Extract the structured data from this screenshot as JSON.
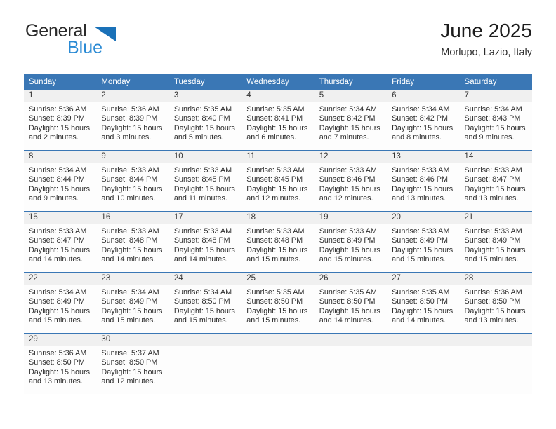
{
  "brand": {
    "name_top": "General",
    "name_bottom": "Blue",
    "triangle_icon": "triangle-icon",
    "accent_color": "#1a71b8",
    "text_color": "#2a8ad4"
  },
  "header": {
    "title": "June 2025",
    "subtitle": "Morlupo, Lazio, Italy"
  },
  "calendar": {
    "header_bg": "#3a77b5",
    "header_text_color": "#ffffff",
    "daynum_band_bg": "#f0f0f0",
    "weekdays": [
      "Sunday",
      "Monday",
      "Tuesday",
      "Wednesday",
      "Thursday",
      "Friday",
      "Saturday"
    ],
    "weeks": [
      [
        {
          "day": "1",
          "sunrise": "Sunrise: 5:36 AM",
          "sunset": "Sunset: 8:39 PM",
          "daylight_line1": "Daylight: 15 hours",
          "daylight_line2": "and 2 minutes."
        },
        {
          "day": "2",
          "sunrise": "Sunrise: 5:36 AM",
          "sunset": "Sunset: 8:39 PM",
          "daylight_line1": "Daylight: 15 hours",
          "daylight_line2": "and 3 minutes."
        },
        {
          "day": "3",
          "sunrise": "Sunrise: 5:35 AM",
          "sunset": "Sunset: 8:40 PM",
          "daylight_line1": "Daylight: 15 hours",
          "daylight_line2": "and 5 minutes."
        },
        {
          "day": "4",
          "sunrise": "Sunrise: 5:35 AM",
          "sunset": "Sunset: 8:41 PM",
          "daylight_line1": "Daylight: 15 hours",
          "daylight_line2": "and 6 minutes."
        },
        {
          "day": "5",
          "sunrise": "Sunrise: 5:34 AM",
          "sunset": "Sunset: 8:42 PM",
          "daylight_line1": "Daylight: 15 hours",
          "daylight_line2": "and 7 minutes."
        },
        {
          "day": "6",
          "sunrise": "Sunrise: 5:34 AM",
          "sunset": "Sunset: 8:42 PM",
          "daylight_line1": "Daylight: 15 hours",
          "daylight_line2": "and 8 minutes."
        },
        {
          "day": "7",
          "sunrise": "Sunrise: 5:34 AM",
          "sunset": "Sunset: 8:43 PM",
          "daylight_line1": "Daylight: 15 hours",
          "daylight_line2": "and 9 minutes."
        }
      ],
      [
        {
          "day": "8",
          "sunrise": "Sunrise: 5:34 AM",
          "sunset": "Sunset: 8:44 PM",
          "daylight_line1": "Daylight: 15 hours",
          "daylight_line2": "and 9 minutes."
        },
        {
          "day": "9",
          "sunrise": "Sunrise: 5:33 AM",
          "sunset": "Sunset: 8:44 PM",
          "daylight_line1": "Daylight: 15 hours",
          "daylight_line2": "and 10 minutes."
        },
        {
          "day": "10",
          "sunrise": "Sunrise: 5:33 AM",
          "sunset": "Sunset: 8:45 PM",
          "daylight_line1": "Daylight: 15 hours",
          "daylight_line2": "and 11 minutes."
        },
        {
          "day": "11",
          "sunrise": "Sunrise: 5:33 AM",
          "sunset": "Sunset: 8:45 PM",
          "daylight_line1": "Daylight: 15 hours",
          "daylight_line2": "and 12 minutes."
        },
        {
          "day": "12",
          "sunrise": "Sunrise: 5:33 AM",
          "sunset": "Sunset: 8:46 PM",
          "daylight_line1": "Daylight: 15 hours",
          "daylight_line2": "and 12 minutes."
        },
        {
          "day": "13",
          "sunrise": "Sunrise: 5:33 AM",
          "sunset": "Sunset: 8:46 PM",
          "daylight_line1": "Daylight: 15 hours",
          "daylight_line2": "and 13 minutes."
        },
        {
          "day": "14",
          "sunrise": "Sunrise: 5:33 AM",
          "sunset": "Sunset: 8:47 PM",
          "daylight_line1": "Daylight: 15 hours",
          "daylight_line2": "and 13 minutes."
        }
      ],
      [
        {
          "day": "15",
          "sunrise": "Sunrise: 5:33 AM",
          "sunset": "Sunset: 8:47 PM",
          "daylight_line1": "Daylight: 15 hours",
          "daylight_line2": "and 14 minutes."
        },
        {
          "day": "16",
          "sunrise": "Sunrise: 5:33 AM",
          "sunset": "Sunset: 8:48 PM",
          "daylight_line1": "Daylight: 15 hours",
          "daylight_line2": "and 14 minutes."
        },
        {
          "day": "17",
          "sunrise": "Sunrise: 5:33 AM",
          "sunset": "Sunset: 8:48 PM",
          "daylight_line1": "Daylight: 15 hours",
          "daylight_line2": "and 14 minutes."
        },
        {
          "day": "18",
          "sunrise": "Sunrise: 5:33 AM",
          "sunset": "Sunset: 8:48 PM",
          "daylight_line1": "Daylight: 15 hours",
          "daylight_line2": "and 15 minutes."
        },
        {
          "day": "19",
          "sunrise": "Sunrise: 5:33 AM",
          "sunset": "Sunset: 8:49 PM",
          "daylight_line1": "Daylight: 15 hours",
          "daylight_line2": "and 15 minutes."
        },
        {
          "day": "20",
          "sunrise": "Sunrise: 5:33 AM",
          "sunset": "Sunset: 8:49 PM",
          "daylight_line1": "Daylight: 15 hours",
          "daylight_line2": "and 15 minutes."
        },
        {
          "day": "21",
          "sunrise": "Sunrise: 5:33 AM",
          "sunset": "Sunset: 8:49 PM",
          "daylight_line1": "Daylight: 15 hours",
          "daylight_line2": "and 15 minutes."
        }
      ],
      [
        {
          "day": "22",
          "sunrise": "Sunrise: 5:34 AM",
          "sunset": "Sunset: 8:49 PM",
          "daylight_line1": "Daylight: 15 hours",
          "daylight_line2": "and 15 minutes."
        },
        {
          "day": "23",
          "sunrise": "Sunrise: 5:34 AM",
          "sunset": "Sunset: 8:49 PM",
          "daylight_line1": "Daylight: 15 hours",
          "daylight_line2": "and 15 minutes."
        },
        {
          "day": "24",
          "sunrise": "Sunrise: 5:34 AM",
          "sunset": "Sunset: 8:50 PM",
          "daylight_line1": "Daylight: 15 hours",
          "daylight_line2": "and 15 minutes."
        },
        {
          "day": "25",
          "sunrise": "Sunrise: 5:35 AM",
          "sunset": "Sunset: 8:50 PM",
          "daylight_line1": "Daylight: 15 hours",
          "daylight_line2": "and 15 minutes."
        },
        {
          "day": "26",
          "sunrise": "Sunrise: 5:35 AM",
          "sunset": "Sunset: 8:50 PM",
          "daylight_line1": "Daylight: 15 hours",
          "daylight_line2": "and 14 minutes."
        },
        {
          "day": "27",
          "sunrise": "Sunrise: 5:35 AM",
          "sunset": "Sunset: 8:50 PM",
          "daylight_line1": "Daylight: 15 hours",
          "daylight_line2": "and 14 minutes."
        },
        {
          "day": "28",
          "sunrise": "Sunrise: 5:36 AM",
          "sunset": "Sunset: 8:50 PM",
          "daylight_line1": "Daylight: 15 hours",
          "daylight_line2": "and 13 minutes."
        }
      ],
      [
        {
          "day": "29",
          "sunrise": "Sunrise: 5:36 AM",
          "sunset": "Sunset: 8:50 PM",
          "daylight_line1": "Daylight: 15 hours",
          "daylight_line2": "and 13 minutes."
        },
        {
          "day": "30",
          "sunrise": "Sunrise: 5:37 AM",
          "sunset": "Sunset: 8:50 PM",
          "daylight_line1": "Daylight: 15 hours",
          "daylight_line2": "and 12 minutes."
        },
        {
          "day": "",
          "sunrise": "",
          "sunset": "",
          "daylight_line1": "",
          "daylight_line2": ""
        },
        {
          "day": "",
          "sunrise": "",
          "sunset": "",
          "daylight_line1": "",
          "daylight_line2": ""
        },
        {
          "day": "",
          "sunrise": "",
          "sunset": "",
          "daylight_line1": "",
          "daylight_line2": ""
        },
        {
          "day": "",
          "sunrise": "",
          "sunset": "",
          "daylight_line1": "",
          "daylight_line2": ""
        },
        {
          "day": "",
          "sunrise": "",
          "sunset": "",
          "daylight_line1": "",
          "daylight_line2": ""
        }
      ]
    ]
  }
}
